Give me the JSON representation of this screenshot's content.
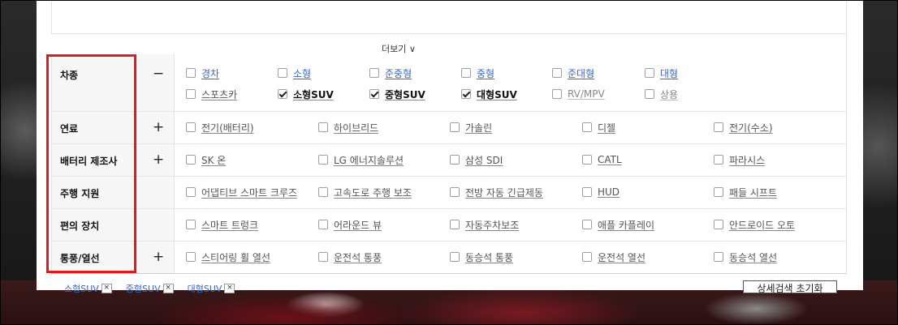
{
  "more_label": "더보기 ∨",
  "rows": [
    {
      "label": "차종",
      "toggle": "−"
    },
    {
      "label": "연료",
      "toggle": "+"
    },
    {
      "label": "배터리 제조사",
      "toggle": "+"
    },
    {
      "label": "주행 지원",
      "toggle": ""
    },
    {
      "label": "편의 장치",
      "toggle": ""
    },
    {
      "label": "통풍/열선",
      "toggle": "+"
    }
  ],
  "car_types_row1": [
    {
      "label": "경차",
      "checked": false
    },
    {
      "label": "소형",
      "checked": false
    },
    {
      "label": "준중형",
      "checked": false
    },
    {
      "label": "중형",
      "checked": false
    },
    {
      "label": "준대형",
      "checked": false
    },
    {
      "label": "대형",
      "checked": false
    }
  ],
  "car_types_row2": [
    {
      "label": "스포츠카",
      "checked": false
    },
    {
      "label": "소형SUV",
      "checked": true
    },
    {
      "label": "중형SUV",
      "checked": true
    },
    {
      "label": "대형SUV",
      "checked": true
    },
    {
      "label": "RV/MPV",
      "checked": false
    },
    {
      "label": "상용",
      "checked": false
    }
  ],
  "fuel": [
    "전기(배터리)",
    "하이브리드",
    "가솔린",
    "디젤",
    "전기(수소)"
  ],
  "battery": [
    "SK 온",
    "LG 에너지솔루션",
    "삼성 SDI",
    "CATL",
    "파라시스"
  ],
  "driving": [
    "어댑티브 스마트 크루즈",
    "고속도로 주행 보조",
    "전방 자동 긴급제동",
    "HUD",
    "패들 시프트"
  ],
  "convenience": [
    "스마트 트렁크",
    "어라운드 뷰",
    "자동주차보조",
    "애플 카플레이",
    "안드로이드 오토"
  ],
  "ventilation": [
    "스티어링 휠 열선",
    "운전석 통풍",
    "동승석 통풍",
    "운전석 열선",
    "동승석 열선"
  ],
  "chips": [
    "소형SUV",
    "중형SUV",
    "대형SUV"
  ],
  "chip_close": "×",
  "reset_label": "상세검색 초기화"
}
